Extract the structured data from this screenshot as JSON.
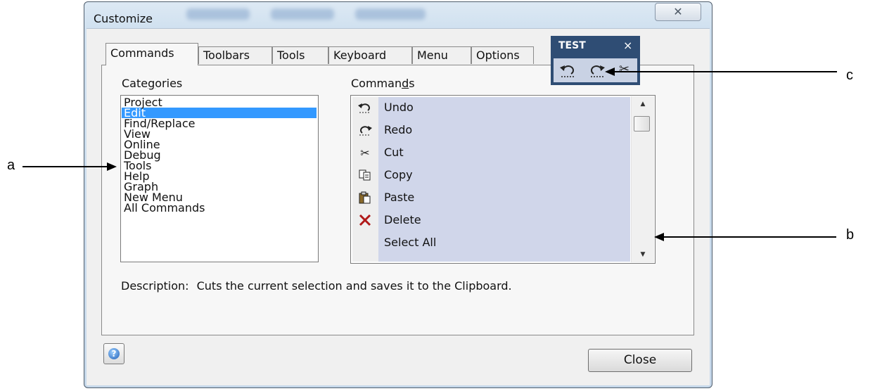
{
  "window": {
    "title": "Customize",
    "close_glyph": "✕"
  },
  "tabs": [
    "Commands",
    "Toolbars",
    "Tools",
    "Keyboard",
    "Menu",
    "Options"
  ],
  "active_tab": "Commands",
  "categories": {
    "label_pre": "Cate",
    "label_ul": "g",
    "label_post": "ories",
    "items": [
      "Project",
      "Edit",
      "Find/Replace",
      "View",
      "Online",
      "Debug",
      "Tools",
      "Help",
      "Graph",
      "New Menu",
      "All Commands"
    ],
    "selected": "Edit"
  },
  "commands": {
    "label_pre": "Comman",
    "label_ul": "d",
    "label_post": "s",
    "items": [
      {
        "label": "Undo",
        "icon": "undo-icon",
        "glyph": "⤺"
      },
      {
        "label": "Redo",
        "icon": "redo-icon",
        "glyph": "⤻"
      },
      {
        "label": "Cut",
        "icon": "scissors-icon",
        "glyph": "✂"
      },
      {
        "label": "Copy",
        "icon": "copy-icon",
        "glyph": "⎘"
      },
      {
        "label": "Paste",
        "icon": "paste-icon",
        "glyph": "📋"
      },
      {
        "label": "Delete",
        "icon": "delete-x-icon",
        "glyph": "✕"
      },
      {
        "label": "Select All",
        "icon": "",
        "glyph": ""
      }
    ]
  },
  "description": {
    "label": "Description:",
    "text": "Cuts the current selection and saves it to the Clipboard."
  },
  "buttons": {
    "help": "?",
    "close": "Close"
  },
  "test_toolbar": {
    "title": "TEST",
    "close": "×",
    "icons": [
      "undo-icon",
      "redo-icon",
      "scissors-icon"
    ]
  },
  "annotations": {
    "a": "a",
    "b": "b",
    "c": "c"
  },
  "colors": {
    "selection": "#3399ff",
    "command_highlight": "#d0d6ea",
    "toolbar_bg": "#2f4d74",
    "delete_red": "#b01818"
  }
}
